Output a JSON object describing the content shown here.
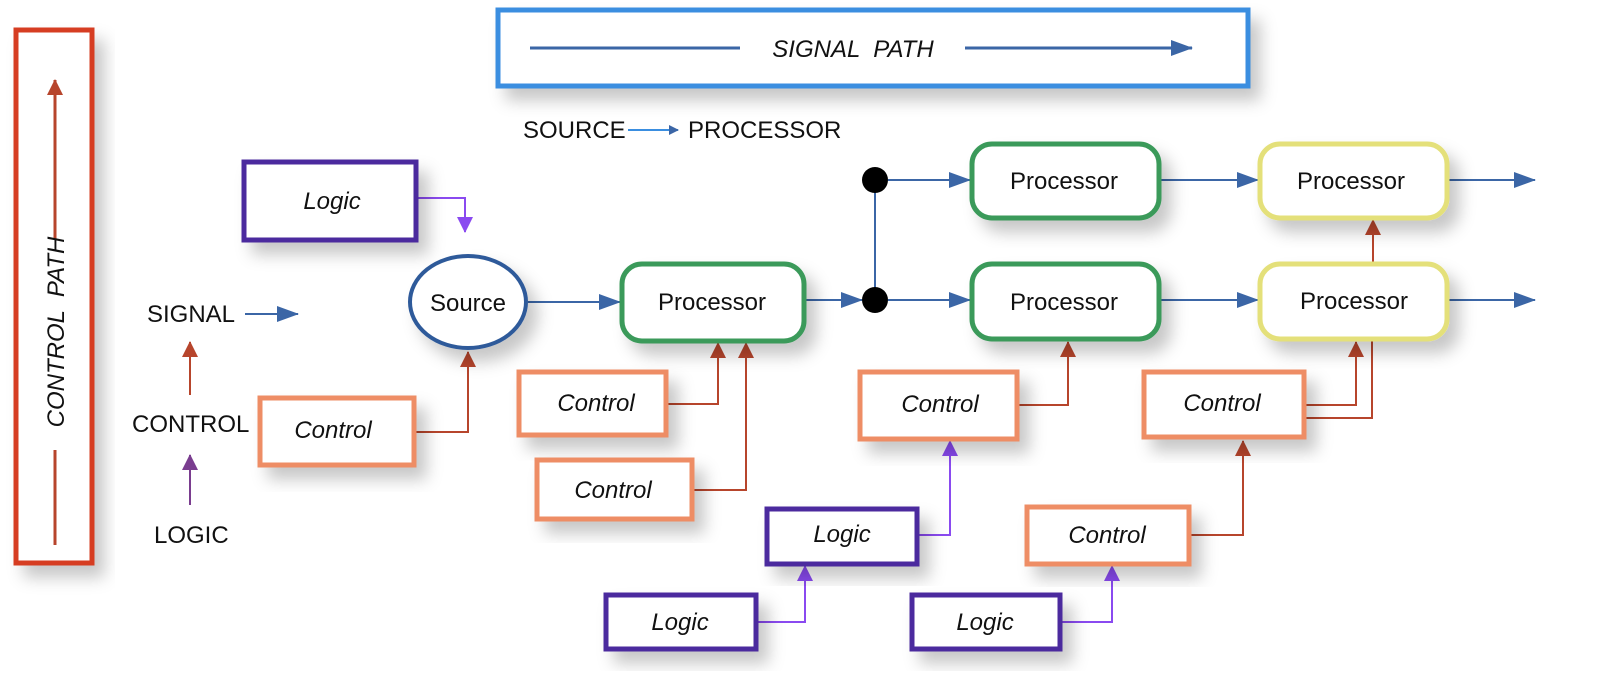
{
  "control_path_label": "CONTROL  PATH",
  "signal_path_label": "SIGNAL  PATH",
  "legend_top": {
    "from": "SOURCE",
    "to": "PROCESSOR"
  },
  "legend_left": {
    "signal": "SIGNAL",
    "control": "CONTROL",
    "logic": "LOGIC"
  },
  "nodes": {
    "source": "Source",
    "processor1": "Processor",
    "processor_top_green": "Processor",
    "processor_bottom_green": "Processor",
    "processor_top_yellow": "Processor",
    "processor_bottom_yellow": "Processor",
    "logic1": "Logic",
    "logic2": "Logic",
    "logic3": "Logic",
    "logic4": "Logic",
    "control1": "Control",
    "control2": "Control",
    "control3": "Control",
    "control4": "Control",
    "control5": "Control",
    "control6": "Control"
  },
  "colors": {
    "control_path": "#d63c24",
    "signal_path": "#3a8ee0",
    "signal_arrow": "#3b66a6",
    "control_arrow": "#b7452c",
    "logic_arrow": "#8a4af0",
    "logic_box": "#4b2a9e",
    "control_box": "#ee8d65",
    "source": "#2f5a9a",
    "processor_green": "#3a9a5a",
    "processor_yellow": "#e4e07a"
  }
}
